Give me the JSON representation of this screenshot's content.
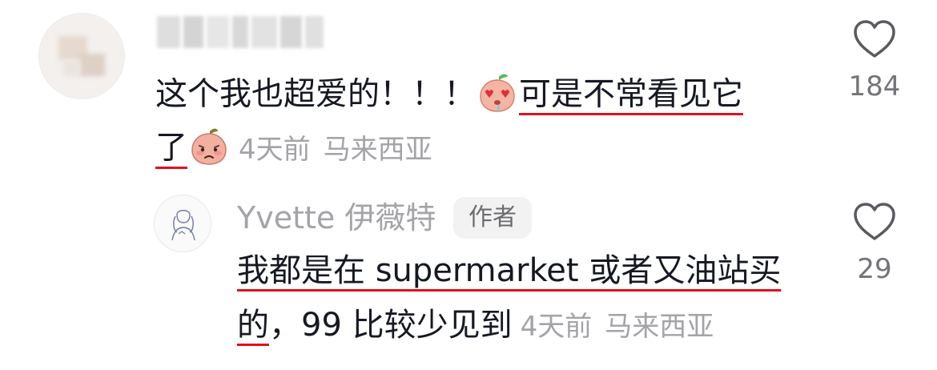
{
  "comment": {
    "text_line1": "这个我也超爱的！！！",
    "text_line1_underlined": "可是不常看见它",
    "text_line2_underlined": "了",
    "time": "4天前",
    "location": "马来西亚",
    "emoji1": "heart-eyes-peach-emoji",
    "emoji2": "sad-peach-emoji",
    "likes": "184"
  },
  "reply": {
    "author_name": "Yvette 伊薇特",
    "author_badge": "作者",
    "text_line1_underlined": "我都是在 supermarket 或者又油站买",
    "text_line2_underlined": "的",
    "text_line2_rest": "，99 比较少见到",
    "time": "4天前",
    "location": "马来西亚",
    "likes": "29"
  },
  "colors": {
    "primary_text": "#161823",
    "secondary_text": "#a3a3a8",
    "underline_accent": "#e0111c",
    "badge_bg": "#f2f2f2"
  },
  "icons": [
    "heart-outline-icon"
  ]
}
